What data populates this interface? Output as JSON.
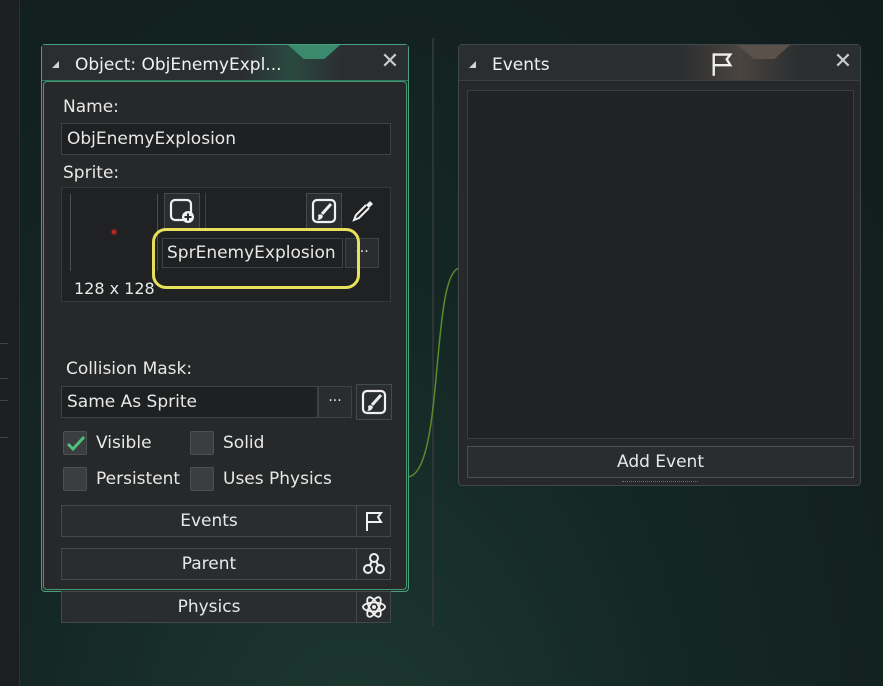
{
  "object_panel": {
    "title": "Object: ObjEnemyExpl...",
    "close_glyph": "✕",
    "name_label": "Name:",
    "name_value": "ObjEnemyExplosion",
    "sprite_label": "Sprite:",
    "sprite_name": "SprEnemyExplosion",
    "sprite_size": "128 x 128",
    "sprite_menu_glyph": "···",
    "collision_label": "Collision Mask:",
    "collision_value": "Same As Sprite",
    "collision_menu_glyph": "···",
    "checkboxes": [
      {
        "label": "Visible",
        "checked": true
      },
      {
        "label": "Solid",
        "checked": false
      },
      {
        "label": "Persistent",
        "checked": false
      },
      {
        "label": "Uses Physics",
        "checked": false
      }
    ],
    "buttons": {
      "events": "Events",
      "parent": "Parent",
      "physics": "Physics"
    },
    "icons": {
      "new_sprite": "add-sprite-icon",
      "edit_sprite": "edit-image-icon",
      "eyedropper": "eyedropper-icon",
      "edit_mask": "edit-image-icon",
      "events": "flag-icon",
      "parent": "hierarchy-icon",
      "physics": "atom-icon"
    },
    "accent_color": "#4a9f7c"
  },
  "events_panel": {
    "title": "Events",
    "close_glyph": "✕",
    "add_event_label": "Add Event",
    "header_icon": "flag-icon"
  },
  "highlight_color": "#e8e05a"
}
